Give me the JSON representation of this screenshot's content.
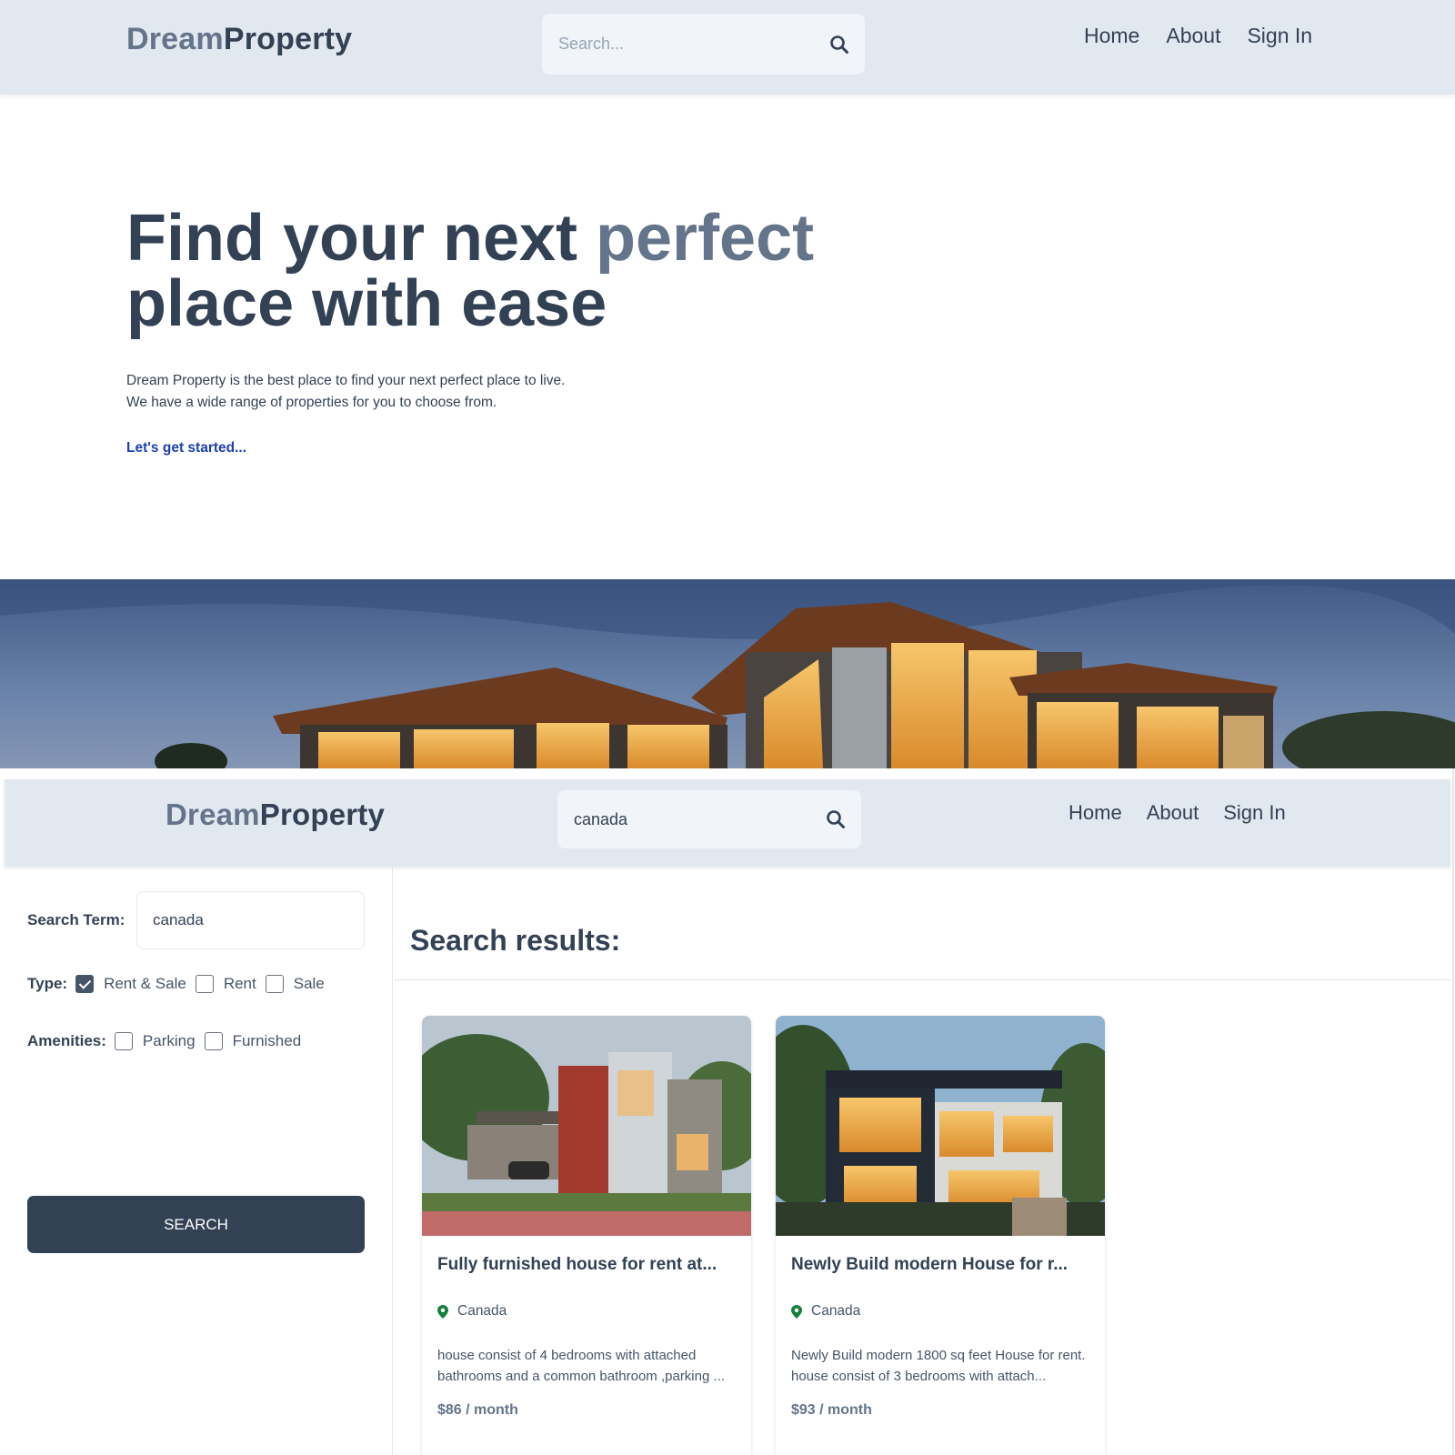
{
  "header": {
    "logo_part1": "Dream",
    "logo_part2": "Property",
    "search_placeholder": "Search...",
    "nav": [
      "Home",
      "About",
      "Sign In"
    ]
  },
  "hero": {
    "title_line1_a": "Find your next ",
    "title_line1_b": "perfect",
    "title_line2": "place with ease",
    "desc_line1": "Dream Property is the best place to find your next perfect place to live.",
    "desc_line2": "We have a wide range of properties for you to choose from.",
    "cta": "Let's get started..."
  },
  "search_page": {
    "header": {
      "logo_part1": "Dream",
      "logo_part2": "Property",
      "search_value": "canada",
      "nav": [
        "Home",
        "About",
        "Sign In"
      ]
    },
    "sidebar": {
      "search_term_label": "Search Term:",
      "search_term_value": "canada",
      "type_label": "Type:",
      "type_options": [
        {
          "label": "Rent & Sale",
          "checked": true
        },
        {
          "label": "Rent",
          "checked": false
        },
        {
          "label": "Sale",
          "checked": false
        }
      ],
      "amenities_label": "Amenities:",
      "amenity_options": [
        {
          "label": "Parking",
          "checked": false
        },
        {
          "label": "Furnished",
          "checked": false
        }
      ],
      "search_button": "SEARCH"
    },
    "results_title": "Search results:",
    "listings": [
      {
        "title": "Fully furnished house for rent at...",
        "location": "Canada",
        "description": "house consist of 4 bedrooms with attached bathrooms and a common bathroom ,parking ...",
        "price": "$86 / month"
      },
      {
        "title": "Newly Build modern House for r...",
        "location": "Canada",
        "description": "Newly Build modern 1800 sq feet House for rent. house consist of 3 bedrooms with attach...",
        "price": "$93 / month"
      }
    ]
  },
  "colors": {
    "header_bg": "#e2e8f0",
    "primary_text": "#334155",
    "accent_text": "#64748b",
    "cta": "#1e40af",
    "button_bg": "#334155",
    "pin": "#15803d"
  },
  "icons": [
    "search-icon",
    "location-pin-icon",
    "checkbox-checked-icon"
  ]
}
